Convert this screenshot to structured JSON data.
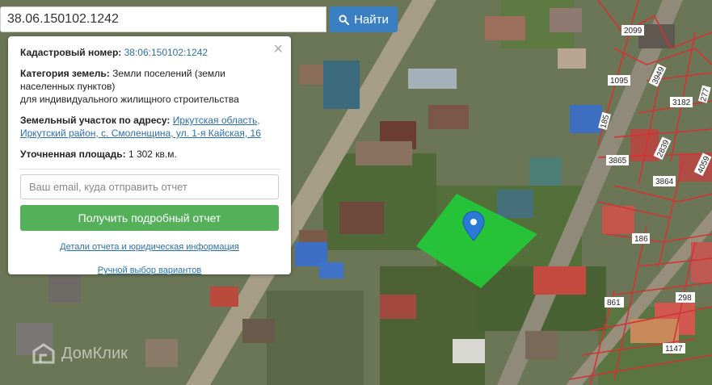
{
  "search": {
    "value": "38.06.150102.1242",
    "button_label": "Найти"
  },
  "popup": {
    "close_label": "×",
    "cadastral_label": "Кадастровый номер:",
    "cadastral_value": "38:06:150102:1242",
    "category_label": "Категория земель:",
    "category_value": "Земли поселений (земли населенных пунктов)",
    "category_use": "для индивидуального жилищного строительства",
    "address_label": "Земельный участок по адресу:",
    "address_line1": "Иркутская область,",
    "address_line2": "Иркутский район, с. Смоленщина, ул. 1-я Кайская, 16",
    "area_label": "Уточненная площадь:",
    "area_value": "1 302 кв.м.",
    "email_placeholder": "Ваш email, куда отправить отчет",
    "report_button": "Получить подробный отчет",
    "details_link": "Детали отчета и юридическая информация",
    "manual_link": "Ручной выбор вариантов"
  },
  "map_labels": [
    "2099",
    "1095",
    "3949",
    "3182",
    "185",
    "3865",
    "2839",
    "3864",
    "4059",
    "186",
    "861",
    "298",
    "1147",
    "277"
  ],
  "watermark": "ДомКлик",
  "colors": {
    "search_button": "#3a7fc1",
    "report_button": "#55b05a",
    "link": "#2a6fb0",
    "parcel_fill": "#1fd13a",
    "parcel_border": "#d33333",
    "pin": "#2a7ad8"
  }
}
